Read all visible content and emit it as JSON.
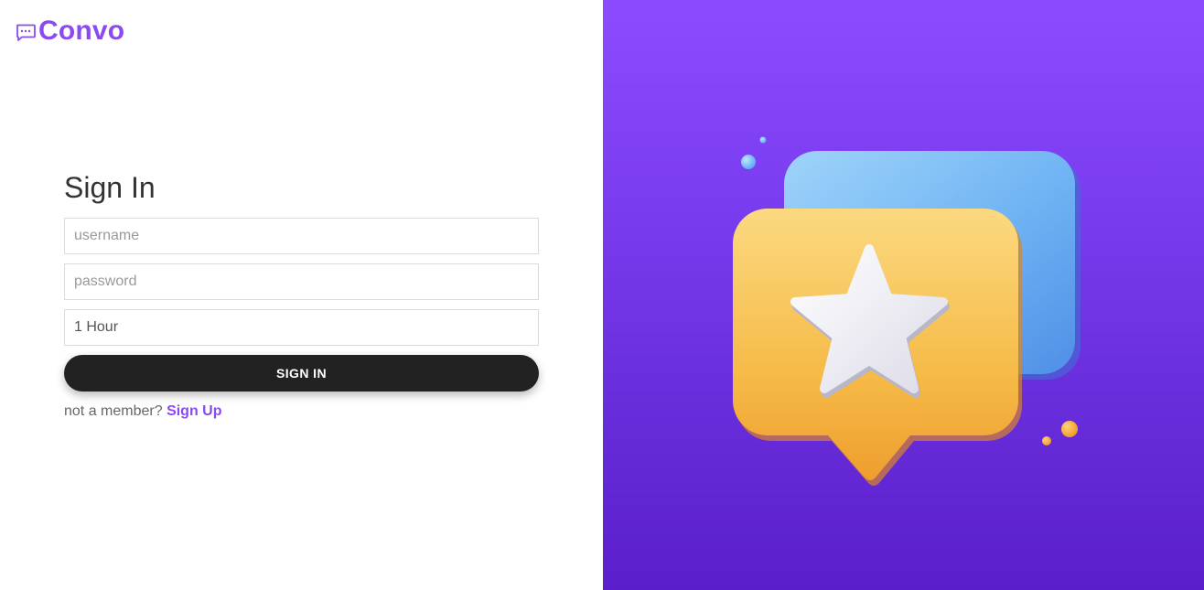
{
  "brand": {
    "name": "Convo",
    "icon": "chat-bubble-icon",
    "color": "#8b4af0"
  },
  "form": {
    "title": "Sign In",
    "username": {
      "placeholder": "username",
      "value": ""
    },
    "password": {
      "placeholder": "password",
      "value": ""
    },
    "duration": {
      "selected": "1 Hour"
    },
    "submit_label": "SIGN IN",
    "member_prompt": "not a member?",
    "signup_label": "Sign Up"
  },
  "hero": {
    "illustration": "chat-bubbles-star-illustration",
    "background_top": "#8c4bff",
    "background_bottom": "#5a1fcb"
  }
}
